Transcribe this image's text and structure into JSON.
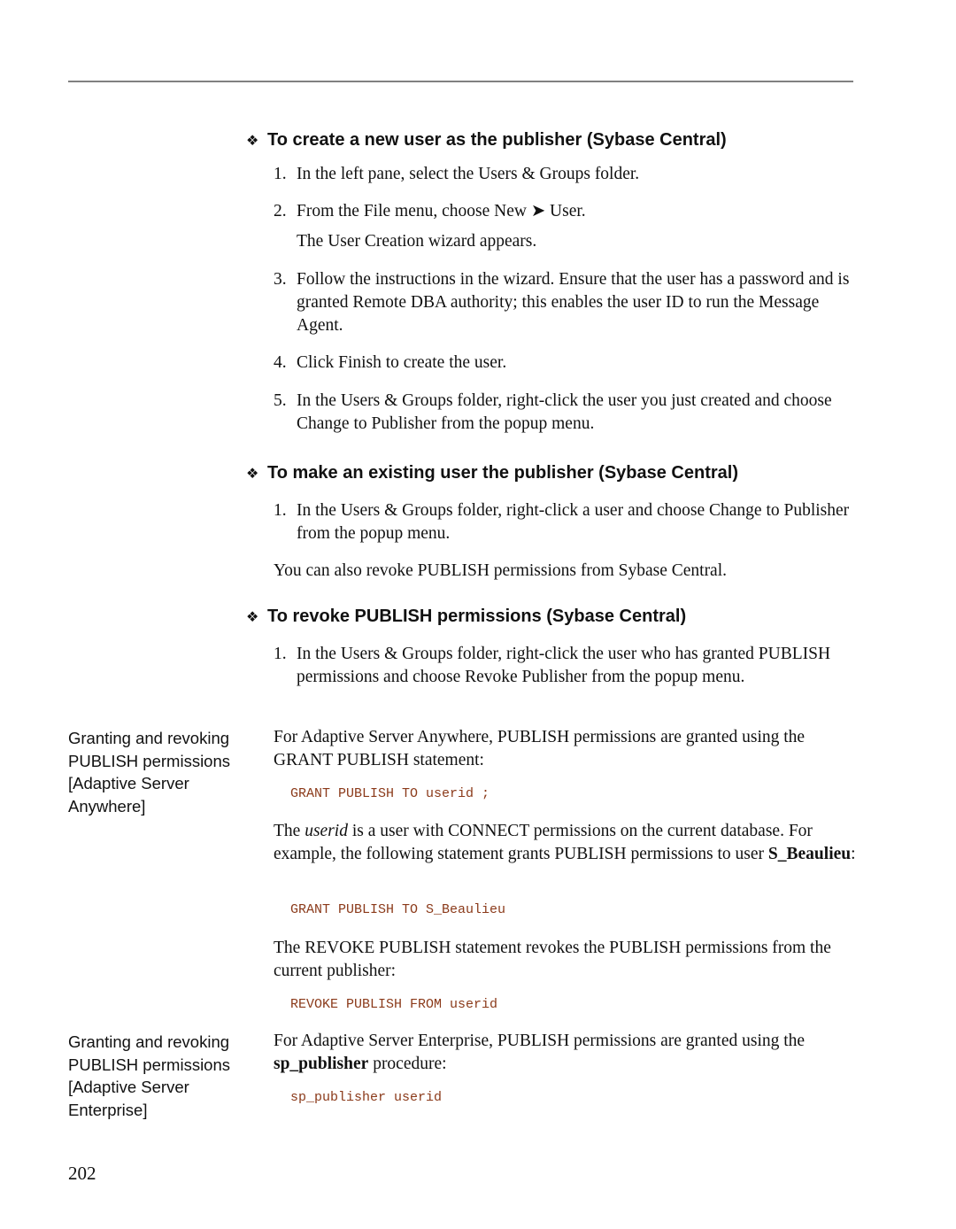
{
  "page": {
    "page_number": "202"
  },
  "sections": [
    {
      "heading": "To create a new user as the publisher (Sybase Central)",
      "steps": [
        {
          "num": "1.",
          "text": "In the left pane, select the Users & Groups folder."
        },
        {
          "num": "2.",
          "text": "From the File menu, choose New ➤ User.",
          "result": "The User Creation wizard appears."
        },
        {
          "num": "3.",
          "text": "Follow the instructions in the wizard. Ensure that the user has a password and is granted Remote DBA authority; this enables the user ID to run the Message Agent."
        },
        {
          "num": "4.",
          "text": "Click Finish to create the user."
        },
        {
          "num": "5.",
          "text": "In the Users & Groups folder, right-click the user you just created and choose Change to Publisher from the popup menu."
        }
      ]
    },
    {
      "heading": "To make an existing user the publisher (Sybase Central)",
      "steps": [
        {
          "num": "1.",
          "text": "In the Users & Groups folder, right-click a user and choose Change to Publisher from the popup menu."
        }
      ],
      "note": "You can also revoke PUBLISH permissions from Sybase Central."
    },
    {
      "heading": "To revoke PUBLISH permissions (Sybase Central)",
      "steps": [
        {
          "num": "1.",
          "text": "In the Users & Groups folder, right-click the user who has granted PUBLISH permissions and choose Revoke Publisher from the popup menu."
        }
      ]
    }
  ],
  "asa": {
    "margin_note": "Granting and revoking PUBLISH permissions [Adaptive Server Anywhere]",
    "intro": "For Adaptive Server Anywhere, PUBLISH permissions are granted using the GRANT PUBLISH statement:",
    "code1": "GRANT PUBLISH TO userid ;",
    "userid_pre": "The ",
    "userid_term": "userid",
    "userid_post": " is a user with CONNECT permissions on the current database. For example, the following statement grants PUBLISH permissions to user ",
    "userid_example": "S_Beaulieu",
    "userid_end": ":",
    "code2": "GRANT PUBLISH TO S_Beaulieu",
    "revoke_text": "The REVOKE PUBLISH statement revokes the PUBLISH permissions from the current publisher:",
    "code3": "REVOKE PUBLISH FROM userid"
  },
  "ase": {
    "margin_note": "Granting and revoking PUBLISH permissions [Adaptive Server Enterprise]",
    "intro_pre": "For Adaptive Server Enterprise, PUBLISH permissions are granted using the ",
    "intro_term": "sp_publisher",
    "intro_post": " procedure:",
    "code": "sp_publisher userid"
  },
  "icons": {
    "heading_bullet": "❖"
  },
  "colors": {
    "code": "#8b3a1a",
    "rule": "#808080"
  }
}
